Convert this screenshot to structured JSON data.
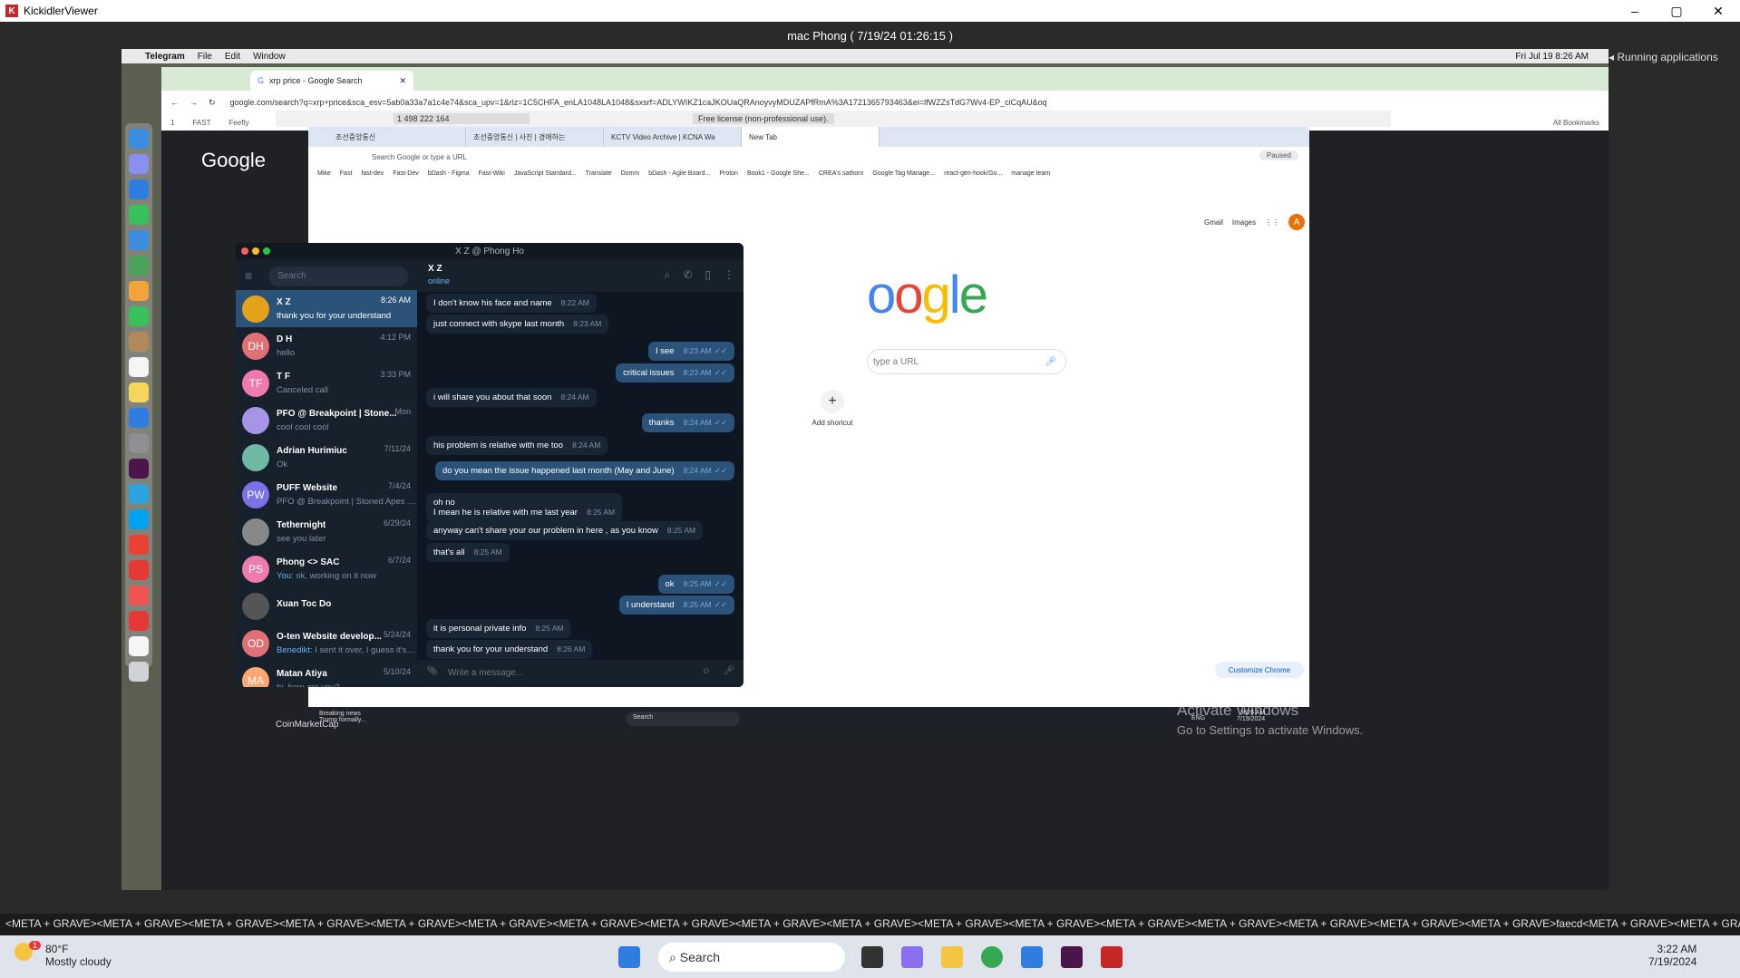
{
  "kv": {
    "title": "KickidlerViewer",
    "header": "mac Phong   ( 7/19/24 01:26:15 )",
    "running_apps": "Running applications"
  },
  "mac_menubar": {
    "app": "Telegram",
    "menus": [
      "File",
      "Edit",
      "Window"
    ],
    "clock": "Fri Jul 19  8:26 AM"
  },
  "chrome": {
    "tab_title": "xrp price - Google Search",
    "url": "google.com/search?q=xrp+price&sca_esv=5ab0a33a7a1c4e74&sca_upv=1&rlz=1C5CHFA_enLA1048LA1048&sxsrf=ADLYWIKZ1caJKOUaQRAnoyvyMDUZAPfRmA%3A1721365793463&ei=lfWZZsTdG7Wv4-EP_ciCqAU&oq=...",
    "bookmarks": [
      "1",
      "FAST",
      "Feefty"
    ],
    "all_bookmarks": "All Bookmarks",
    "google_logo": "Google"
  },
  "vm_bar": {
    "field": "1 498 222 164",
    "license": "Free license (non-professional use)."
  },
  "inner_chrome": {
    "tabs": [
      "조선중앙통신",
      "조선중앙통신 | 사진 | 경애하는",
      "KCTV Video Archive | KCNA Wa",
      "New Tab"
    ],
    "url_placeholder": "Search Google or type a URL",
    "paused": "Paused",
    "bookmarks": [
      "Mike",
      "Fast",
      "fast-dev",
      "Fast-Dev",
      "bDash - Figma",
      "Fast-Wiki",
      "JavaScript Standard...",
      "Translate",
      "Domm",
      "bDash - Agile Board...",
      "Proton",
      "Book1 - Google She...",
      "CREA's sathorn",
      "Google Tag Manage...",
      "react-gtm-hook/Go...",
      "manage team"
    ],
    "links": [
      "Gmail",
      "Images"
    ],
    "avatar": "A",
    "google": "Google",
    "search_placeholder": "type a URL",
    "add_shortcut": "Add shortcut",
    "customize": "Customize Chrome"
  },
  "win_taskbar": {
    "news_title": "Breaking news",
    "news_sub": "Trump formally...",
    "search": "Search",
    "lang": "ENG",
    "time": "8:26 AM",
    "date": "7/19/2024"
  },
  "activate": {
    "line1": "Activate Windows",
    "line2": "Go to Settings to activate Windows."
  },
  "coinmarketcap": "CoinMarketCap",
  "telegram": {
    "window_title": "X Z @ Phong Ho",
    "search_placeholder": "Search",
    "chats": [
      {
        "initials": "",
        "name": "X Z",
        "preview": "thank you for your understand",
        "time": "8:26 AM",
        "color": "#e3a21a"
      },
      {
        "initials": "DH",
        "name": "D H",
        "preview": "hello",
        "time": "4:12 PM",
        "color": "#e17076"
      },
      {
        "initials": "TF",
        "name": "T F",
        "preview": "Canceled call",
        "time": "3:33 PM",
        "color": "#ee7aae"
      },
      {
        "initials": "",
        "name": "PFO @ Breakpoint | Stone...",
        "preview": "cool cool cool",
        "time": "Mon",
        "color": "#a695e7"
      },
      {
        "initials": "",
        "name": "Adrian Hurimiuc",
        "preview": "Ok",
        "time": "7/11/24",
        "color": "#6fb9a4"
      },
      {
        "initials": "PW",
        "name": "PUFF Website",
        "preview": "PFO @ Breakpoint | Stoned Apes | ...",
        "time": "7/4/24",
        "color": "#7b72e9"
      },
      {
        "initials": "",
        "name": "Tethernight",
        "preview": "see you later",
        "time": "6/29/24",
        "color": "#888888"
      },
      {
        "initials": "PS",
        "name": "Phong <> SAC",
        "preview_prefix": "You:",
        "preview": "ok, working on it now",
        "time": "6/7/24",
        "color": "#ee7aae"
      },
      {
        "initials": "",
        "name": "Xuan Toc Do",
        "preview": "",
        "time": "",
        "color": "#555555"
      },
      {
        "initials": "OD",
        "name": "O-ten Website develop...",
        "preview_prefix": "Benedikt:",
        "preview": "I sent it over, I guess it's g...",
        "time": "5/24/24",
        "color": "#e17076"
      },
      {
        "initials": "MA",
        "name": "Matan Atiya",
        "preview": "hi, how are you?",
        "time": "5/10/24",
        "color": "#faa774"
      }
    ],
    "contact": {
      "name": "X Z",
      "status": "online"
    },
    "messages": [
      {
        "dir": "in",
        "text": "I don't know his face and name",
        "time": "8:22 AM"
      },
      {
        "dir": "in",
        "text": "just connect with skype last month",
        "time": "8:23 AM"
      },
      {
        "dir": "out",
        "text": "I see",
        "time": "8:23 AM"
      },
      {
        "dir": "out",
        "text": "critical issues",
        "time": "8:23 AM"
      },
      {
        "dir": "in",
        "text": "i will share you about that soon",
        "time": "8:24 AM"
      },
      {
        "dir": "out",
        "text": "thanks",
        "time": "8:24 AM"
      },
      {
        "dir": "in",
        "text": "his problem is relative with me too",
        "time": "8:24 AM"
      },
      {
        "dir": "out",
        "text": "do you mean the issue happened last month (May and June)",
        "time": "8:24 AM"
      },
      {
        "dir": "in",
        "text": "oh no",
        "text2": "I mean he is relative with me last year",
        "time": "8:25 AM"
      },
      {
        "dir": "in",
        "text": "anyway can't share your our problem in here , as you know",
        "time": "8:25 AM"
      },
      {
        "dir": "in",
        "text": "that's all",
        "time": "8:25 AM"
      },
      {
        "dir": "out",
        "text": "ok",
        "time": "8:25 AM"
      },
      {
        "dir": "out",
        "text": "I understand",
        "time": "8:25 AM"
      },
      {
        "dir": "in",
        "text": "it is personal private info",
        "time": "8:25 AM"
      },
      {
        "dir": "in",
        "text": "thank you for your understand",
        "time": "8:26 AM"
      }
    ],
    "input_placeholder": "Write a message..."
  },
  "keylog": "<META + GRAVE><META + GRAVE><META + GRAVE><META + GRAVE><META + GRAVE><META + GRAVE><META + GRAVE><META + GRAVE><META + GRAVE><META + GRAVE><META + GRAVE><META + GRAVE><META + GRAVE><META + GRAVE><META + GRAVE><META + GRAVE><META + GRAVE>faecd<META + GRAVE><META + GRAVE><META + GRAVE><META + GRAVE><META + GRAVE><META + G",
  "taskbar": {
    "temp": "80°F",
    "weather": "Mostly cloudy",
    "weather_badge": "1",
    "search": "Search",
    "time": "3:22 AM",
    "date": "7/19/2024"
  }
}
